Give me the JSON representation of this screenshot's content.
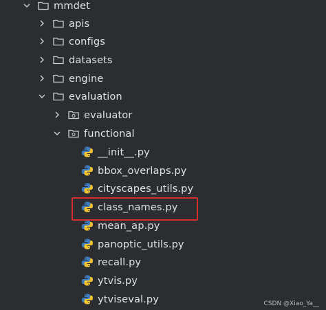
{
  "tree": {
    "root": {
      "label": "mmdet",
      "icon": "folder-icon",
      "state": "expanded"
    },
    "level1": [
      {
        "label": "apis",
        "icon": "folder-icon",
        "state": "collapsed"
      },
      {
        "label": "configs",
        "icon": "folder-icon",
        "state": "collapsed"
      },
      {
        "label": "datasets",
        "icon": "folder-icon",
        "state": "collapsed"
      },
      {
        "label": "engine",
        "icon": "folder-icon",
        "state": "collapsed"
      },
      {
        "label": "evaluation",
        "icon": "folder-icon",
        "state": "expanded"
      }
    ],
    "evaluation_children": [
      {
        "label": "evaluator",
        "icon": "folder-icon",
        "state": "collapsed"
      },
      {
        "label": "functional",
        "icon": "folder-icon",
        "state": "expanded"
      }
    ],
    "functional_files": [
      {
        "label": "__init__.py",
        "icon": "python-file-icon"
      },
      {
        "label": "bbox_overlaps.py",
        "icon": "python-file-icon"
      },
      {
        "label": "cityscapes_utils.py",
        "icon": "python-file-icon"
      },
      {
        "label": "class_names.py",
        "icon": "python-file-icon"
      },
      {
        "label": "mean_ap.py",
        "icon": "python-file-icon"
      },
      {
        "label": "panoptic_utils.py",
        "icon": "python-file-icon"
      },
      {
        "label": "recall.py",
        "icon": "python-file-icon"
      },
      {
        "label": "ytvis.py",
        "icon": "python-file-icon"
      },
      {
        "label": "ytviseval.py",
        "icon": "python-file-icon"
      }
    ]
  },
  "highlight": {
    "target": "class_names.py",
    "color": "#d62d2d"
  },
  "watermark": {
    "text": "CSDN @Xiao_Ya__"
  },
  "colors": {
    "background": "#2b2d30",
    "text": "#dfe1e5",
    "icon": "#ced0d6",
    "python_blue": "#3f7dc3",
    "python_yellow": "#f1c232"
  }
}
